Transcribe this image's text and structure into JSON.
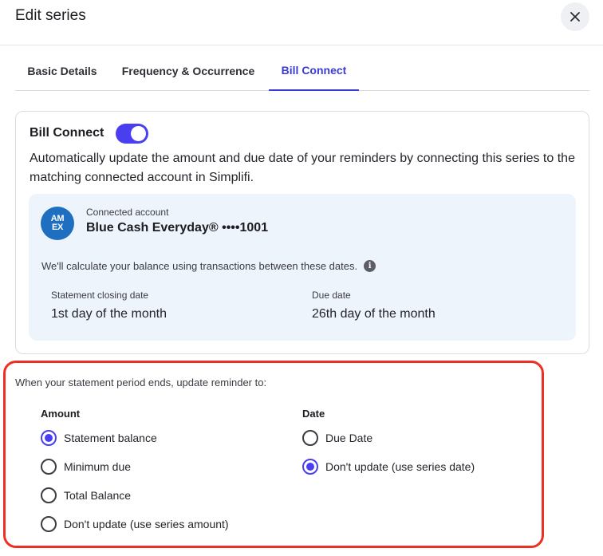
{
  "dialog": {
    "title": "Edit series",
    "close_icon": "close-icon"
  },
  "tabs": [
    {
      "label": "Basic Details",
      "active": false
    },
    {
      "label": "Frequency & Occurrence",
      "active": false
    },
    {
      "label": "Bill Connect",
      "active": true
    }
  ],
  "bill_connect": {
    "title": "Bill Connect",
    "enabled": true,
    "description": "Automatically update the amount and due date of your reminders by connecting this series to the matching connected account in Simplifi.",
    "account": {
      "logo_text_top": "AM",
      "logo_text_bottom": "EX",
      "label": "Connected account",
      "name": "Blue Cash Everyday® ••••1001"
    },
    "calc_note": "We'll calculate your balance using transactions between these dates.",
    "info_icon": "info-icon",
    "statement_closing": {
      "label": "Statement closing date",
      "value": "1st day of the month"
    },
    "due_date": {
      "label": "Due date",
      "value": "26th day of the month"
    }
  },
  "update_section": {
    "prompt": "When your statement period ends, update reminder to:",
    "amount": {
      "label": "Amount",
      "options": [
        {
          "label": "Statement balance",
          "checked": true
        },
        {
          "label": "Minimum due",
          "checked": false
        },
        {
          "label": "Total Balance",
          "checked": false
        },
        {
          "label": "Don't update (use series amount)",
          "checked": false
        }
      ]
    },
    "date": {
      "label": "Date",
      "options": [
        {
          "label": "Due Date",
          "checked": false
        },
        {
          "label": "Don't update (use series date)",
          "checked": true
        }
      ]
    }
  },
  "colors": {
    "accent": "#4a3ff0",
    "tab_active": "#3b3bd6",
    "highlight_border": "#ee2f23",
    "info_panel_bg": "#eef4fb",
    "amex_blue": "#1f6fc1"
  }
}
